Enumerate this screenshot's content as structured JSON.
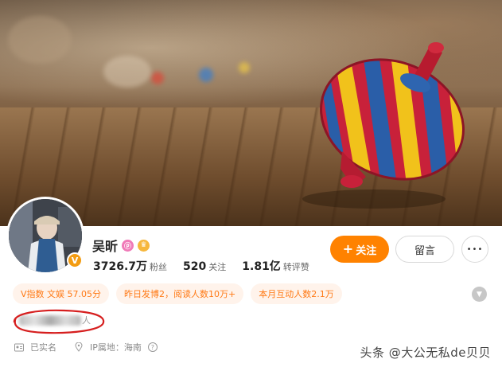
{
  "profile": {
    "name": "吴昕",
    "stats": [
      {
        "value": "3726.7万",
        "label": "粉丝"
      },
      {
        "value": "520",
        "label": "关注"
      },
      {
        "value": "1.81亿",
        "label": "转评赞"
      }
    ],
    "follow_label": "关注",
    "message_label": "留言",
    "more_label": "•••",
    "verify_badge": "V"
  },
  "chips": [
    "V指数 文娱 57.05分",
    "昨日发博2，阅读人数10万+",
    "本月互动人数2.1万"
  ],
  "intro": {
    "visible_tail": "人"
  },
  "meta": {
    "verified_label": "已实名",
    "ip_label": "IP属地：海南",
    "help_mark": "?"
  },
  "watermark": "头条 @大公无私de贝贝",
  "colors": {
    "accent": "#ff8200",
    "chip_text": "#ff7a16",
    "chip_bg": "#fff3eb",
    "annotation_red": "#d61f1f"
  }
}
